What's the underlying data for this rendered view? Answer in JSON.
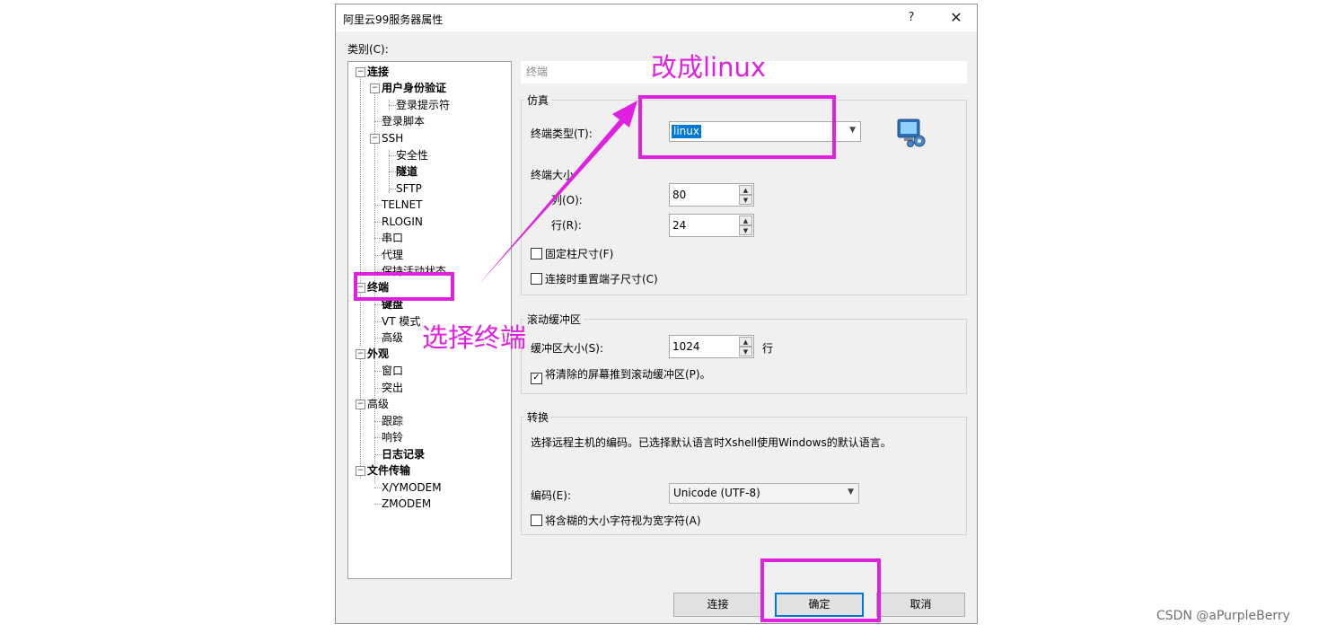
{
  "dialog": {
    "title": "阿里云99服务器属性",
    "help": "?",
    "close": "✕",
    "category_label": "类别(C):"
  },
  "tree": [
    {
      "label": "连接",
      "bold": true,
      "box": "⊟"
    },
    {
      "label": "用户身份验证",
      "bold": true,
      "box": "⊟"
    },
    {
      "label": "登录提示符",
      "bold": false
    },
    {
      "label": "登录脚本",
      "bold": false
    },
    {
      "label": "SSH",
      "bold": false,
      "box": "⊟"
    },
    {
      "label": "安全性",
      "bold": false
    },
    {
      "label": "隧道",
      "bold": true
    },
    {
      "label": "SFTP",
      "bold": false
    },
    {
      "label": "TELNET",
      "bold": false
    },
    {
      "label": "RLOGIN",
      "bold": false
    },
    {
      "label": "串口",
      "bold": false
    },
    {
      "label": "代理",
      "bold": false
    },
    {
      "label": "保持活动状态",
      "bold": false
    },
    {
      "label": "终端",
      "bold": true,
      "box": "⊟"
    },
    {
      "label": "键盘",
      "bold": true
    },
    {
      "label": "VT 模式",
      "bold": false
    },
    {
      "label": "高级",
      "bold": false
    },
    {
      "label": "外观",
      "bold": true,
      "box": "⊟"
    },
    {
      "label": "窗口",
      "bold": false
    },
    {
      "label": "突出",
      "bold": false
    },
    {
      "label": "高级",
      "bold": false,
      "box": "⊟"
    },
    {
      "label": "跟踪",
      "bold": false
    },
    {
      "label": "响铃",
      "bold": false
    },
    {
      "label": "日志记录",
      "bold": true
    },
    {
      "label": "文件传输",
      "bold": true,
      "box": "⊟"
    },
    {
      "label": "X/YMODEM",
      "bold": false
    },
    {
      "label": "ZMODEM",
      "bold": false
    }
  ],
  "panel": {
    "header": "终端",
    "emulation": {
      "group_label": "仿真",
      "terminal_type_label": "终端类型(T):",
      "terminal_type_value": "linux",
      "size_label": "终端大小",
      "cols_label": "列(O):",
      "cols_value": "80",
      "rows_label": "行(R):",
      "rows_value": "24",
      "fixed_size": "固定柱尺寸(F)",
      "fixed_size_checked": false,
      "reset_on_connect": "连接时重置端子尺寸(C)",
      "reset_on_connect_checked": false
    },
    "scrollback": {
      "group_label": "滚动缓冲区",
      "size_label": "缓冲区大小(S):",
      "size_value": "1024",
      "unit": "行",
      "push_clear": "将清除的屏幕推到滚动缓冲区(P)。",
      "push_clear_checked": true
    },
    "conversion": {
      "group_label": "转换",
      "description": "选择远程主机的编码。已选择默认语言时Xshell使用Windows的默认语言。",
      "encoding_label": "编码(E):",
      "encoding_value": "Unicode (UTF-8)",
      "ambiguous_wide": "将含糊的大小字符视为宽字符(A)",
      "ambiguous_wide_checked": false
    }
  },
  "buttons": {
    "connect": "连接",
    "ok": "确定",
    "cancel": "取消"
  },
  "annotations": {
    "change_to": "改成linux",
    "select_terminal": "选择终端",
    "color": "#e020e0"
  },
  "watermark": "CSDN @aPurpleBerry",
  "colors": {
    "selection": "#0078d7",
    "dialog_bg": "#f0f0f0"
  }
}
